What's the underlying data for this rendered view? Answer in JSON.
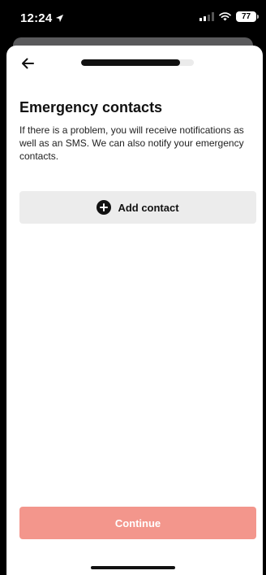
{
  "status_bar": {
    "time": "12:24",
    "battery": "77"
  },
  "header": {
    "progress": 0.88
  },
  "main": {
    "title": "Emergency contacts",
    "description": "If there is a problem, you will receive notifications as well as an SMS. We can also notify your emergency contacts.",
    "add_contact_label": "Add contact"
  },
  "footer": {
    "continue_label": "Continue"
  },
  "colors": {
    "continue_button": "#f3968c",
    "progress_fill": "#111111",
    "add_button_bg": "#ececec"
  },
  "icons": {
    "location": "location-arrow-icon",
    "signal": "signal-icon",
    "wifi": "wifi-icon",
    "battery": "battery-icon",
    "back": "back-arrow-icon",
    "add": "plus-circle-icon"
  }
}
